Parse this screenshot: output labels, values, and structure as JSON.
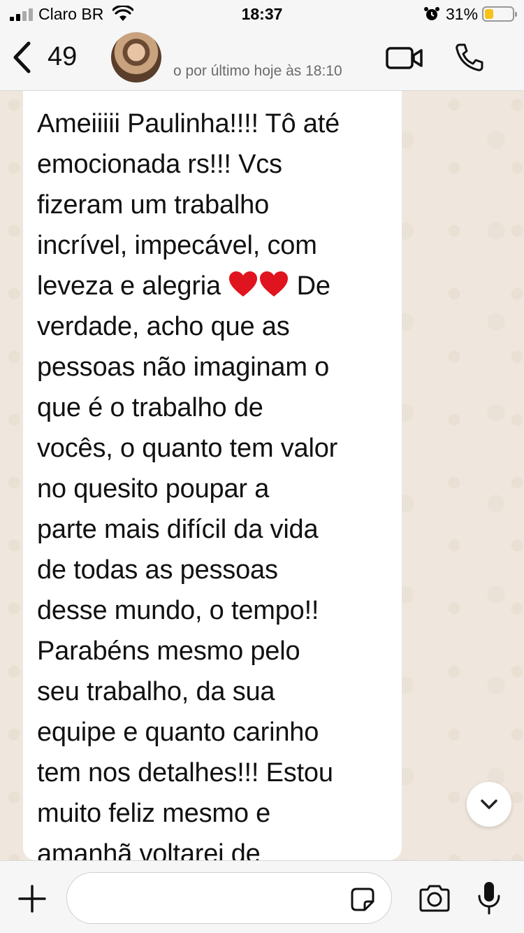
{
  "status_bar": {
    "carrier": "Claro BR",
    "time": "18:37",
    "battery_percent": "31%",
    "battery_level": 0.31,
    "battery_color": "#f7c21a"
  },
  "header": {
    "unread_count": "49",
    "last_seen": "o por último hoje às 18:10",
    "icons": [
      "chevron-left-icon",
      "avatar",
      "video-camera-icon",
      "phone-icon"
    ]
  },
  "chat": {
    "message_part1": "Ameiiiii Paulinha!!!! Tô até\nemocionada rs!!! Vcs\nfizeram um trabalho\nincrível, impecável, com\nleveza e alegria ",
    "emoji": "❤️❤️",
    "message_part2": " De\nverdade, acho que as\npessoas não imaginam o\nque é o trabalho de\nvocês, o quanto tem valor\nno quesito poupar a\nparte mais difícil da vida\nde todas as pessoas\ndesse mundo, o tempo!!\nParabéns mesmo pelo\nseu trabalho, da sua\nequipe e quanto carinho\ntem nos detalhes!!! Estou\nmuito feliz mesmo e\namanhã voltarei de",
    "bubble_color": "#ffffff",
    "background_color": "#efe7dd"
  },
  "input_bar": {
    "placeholder": "",
    "icons": [
      "plus-icon",
      "sticker-icon",
      "camera-icon",
      "microphone-icon"
    ]
  }
}
